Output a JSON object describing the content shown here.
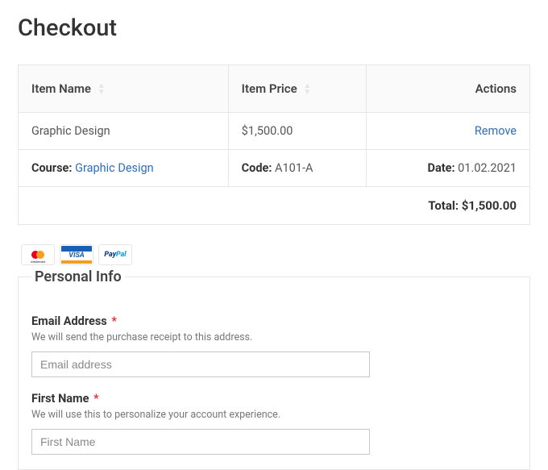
{
  "page_title": "Checkout",
  "table": {
    "headers": {
      "item_name": "Item Name",
      "item_price": "Item Price",
      "actions": "Actions"
    },
    "rows": [
      {
        "name": "Graphic Design",
        "price": "$1,500.00",
        "remove_label": "Remove"
      }
    ],
    "detail": {
      "course_label": "Course:",
      "course_value": "Graphic Design",
      "code_label": "Code:",
      "code_value": "A101-A",
      "date_label": "Date:",
      "date_value": "01.02.2021"
    },
    "total": {
      "label": "Total:",
      "amount": "$1,500.00"
    }
  },
  "payment_methods": [
    "mastercard",
    "visa",
    "paypal"
  ],
  "form": {
    "legend": "Personal Info",
    "fields": {
      "email": {
        "label": "Email Address",
        "required_mark": "*",
        "help": "We will send the purchase receipt to this address.",
        "placeholder": "Email address"
      },
      "first_name": {
        "label": "First Name",
        "required_mark": "*",
        "help": "We will use this to personalize your account experience.",
        "placeholder": "First Name"
      }
    }
  },
  "colors": {
    "link": "#2e6fb5",
    "required": "#d33",
    "border": "#e6e6e6"
  }
}
